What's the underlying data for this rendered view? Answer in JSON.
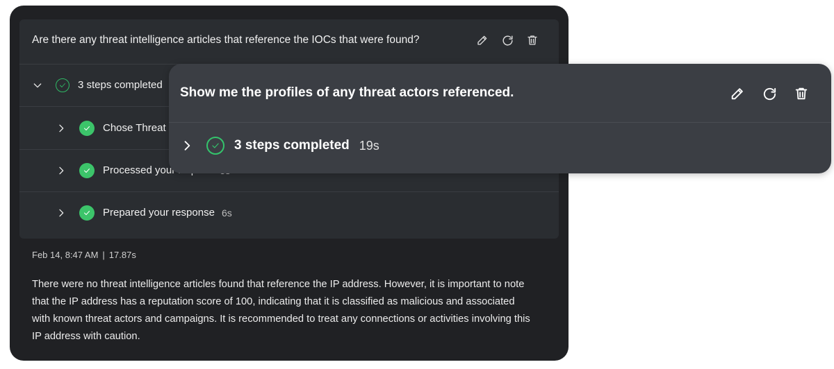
{
  "main": {
    "query_text": "Are there any threat intelligence articles that reference the IOCs that were found?",
    "actions": [
      "edit-icon",
      "regenerate-icon",
      "delete-icon"
    ],
    "summary": {
      "label": "3 steps completed",
      "expanded": true
    },
    "steps": [
      {
        "label": "Chose Threat",
        "duration": ""
      },
      {
        "label": "Processed your request",
        "duration": "5s"
      },
      {
        "label": "Prepared your response",
        "duration": "6s"
      }
    ],
    "meta": {
      "timestamp": "Feb 14, 8:47 AM",
      "separator": "|",
      "elapsed": "17.87s"
    },
    "answer": "There were no threat intelligence articles found that reference the IP address. However, it is important to note that the IP address has a reputation score of 100, indicating that it is classified as malicious and associated with known threat actors and campaigns. It is recommended to treat any connections or activities involving this IP address with caution."
  },
  "overlay": {
    "query_text": "Show me the profiles of any threat actors referenced.",
    "actions": [
      "edit-icon",
      "regenerate-icon",
      "delete-icon"
    ],
    "summary": {
      "label": "3 steps completed",
      "duration": "19s",
      "expanded": false
    }
  },
  "colors": {
    "card_bg": "#202124",
    "block_bg": "#2a2d31",
    "overlay_bg": "#3b3e44",
    "success_green": "#3cc46a"
  }
}
